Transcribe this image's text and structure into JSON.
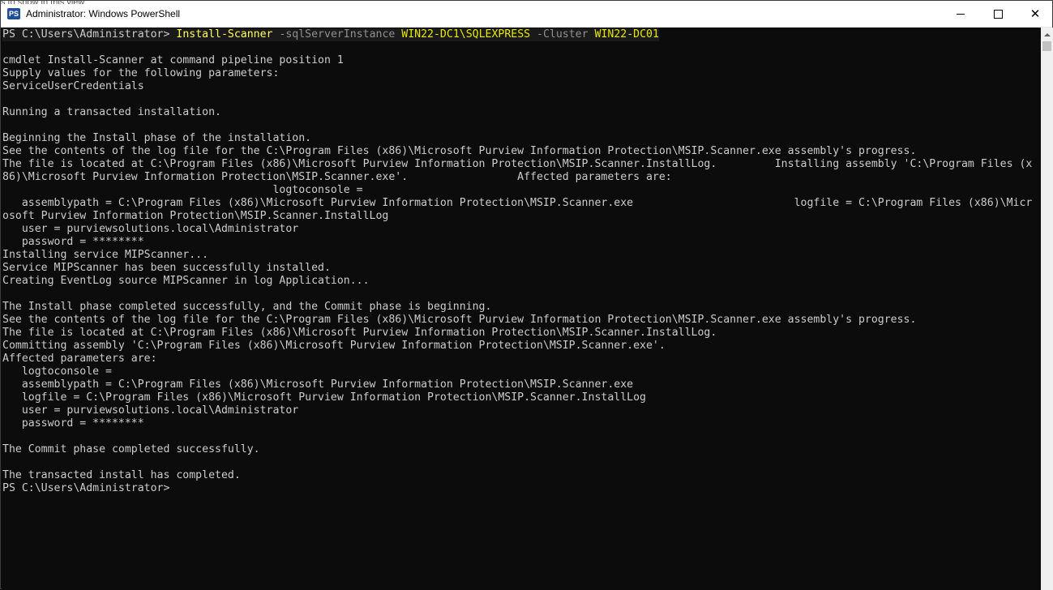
{
  "window": {
    "title": "Administrator: Windows PowerShell",
    "app_icon": "powershell-icon",
    "icon_glyph": "PS",
    "background_sliver_text": "s to show in this view.",
    "controls": {
      "minimize": "minimize-icon",
      "maximize": "maximize-icon",
      "close": "close-icon",
      "close_glyph": "✕"
    }
  },
  "colors": {
    "console_bg": "#0c0c0c",
    "console_fg": "#cccccc",
    "command_yellow": "#ffff66",
    "parameter_gray": "#909090"
  },
  "console": {
    "command": {
      "prompt": "PS C:\\Users\\Administrator> ",
      "cmdlet": "Install-Scanner",
      "param1": "-sqlServerInstance",
      "arg1": "WIN22-DC1\\SQLEXPRESS",
      "param2": "-Cluster",
      "arg2": "WIN22-DC01"
    },
    "lines": [
      "cmdlet Install-Scanner at command pipeline position 1",
      "Supply values for the following parameters:",
      "ServiceUserCredentials",
      "",
      "Running a transacted installation.",
      "",
      "Beginning the Install phase of the installation.",
      "See the contents of the log file for the C:\\Program Files (x86)\\Microsoft Purview Information Protection\\MSIP.Scanner.exe assembly's progress.",
      "The file is located at C:\\Program Files (x86)\\Microsoft Purview Information Protection\\MSIP.Scanner.InstallLog.         Installing assembly 'C:\\Program Files (x",
      "86)\\Microsoft Purview Information Protection\\MSIP.Scanner.exe'.                 Affected parameters are:",
      "                                          logtoconsole =",
      "   assemblypath = C:\\Program Files (x86)\\Microsoft Purview Information Protection\\MSIP.Scanner.exe                         logfile = C:\\Program Files (x86)\\Micr",
      "osoft Purview Information Protection\\MSIP.Scanner.InstallLog",
      "   user = purviewsolutions.local\\Administrator",
      "   password = ********",
      "Installing service MIPScanner...",
      "Service MIPScanner has been successfully installed.",
      "Creating EventLog source MIPScanner in log Application...",
      "",
      "The Install phase completed successfully, and the Commit phase is beginning.",
      "See the contents of the log file for the C:\\Program Files (x86)\\Microsoft Purview Information Protection\\MSIP.Scanner.exe assembly's progress.",
      "The file is located at C:\\Program Files (x86)\\Microsoft Purview Information Protection\\MSIP.Scanner.InstallLog.",
      "Committing assembly 'C:\\Program Files (x86)\\Microsoft Purview Information Protection\\MSIP.Scanner.exe'.",
      "Affected parameters are:",
      "   logtoconsole =",
      "   assemblypath = C:\\Program Files (x86)\\Microsoft Purview Information Protection\\MSIP.Scanner.exe",
      "   logfile = C:\\Program Files (x86)\\Microsoft Purview Information Protection\\MSIP.Scanner.InstallLog",
      "   user = purviewsolutions.local\\Administrator",
      "   password = ********",
      "",
      "The Commit phase completed successfully.",
      "",
      "The transacted install has completed.",
      "PS C:\\Users\\Administrator>"
    ]
  }
}
